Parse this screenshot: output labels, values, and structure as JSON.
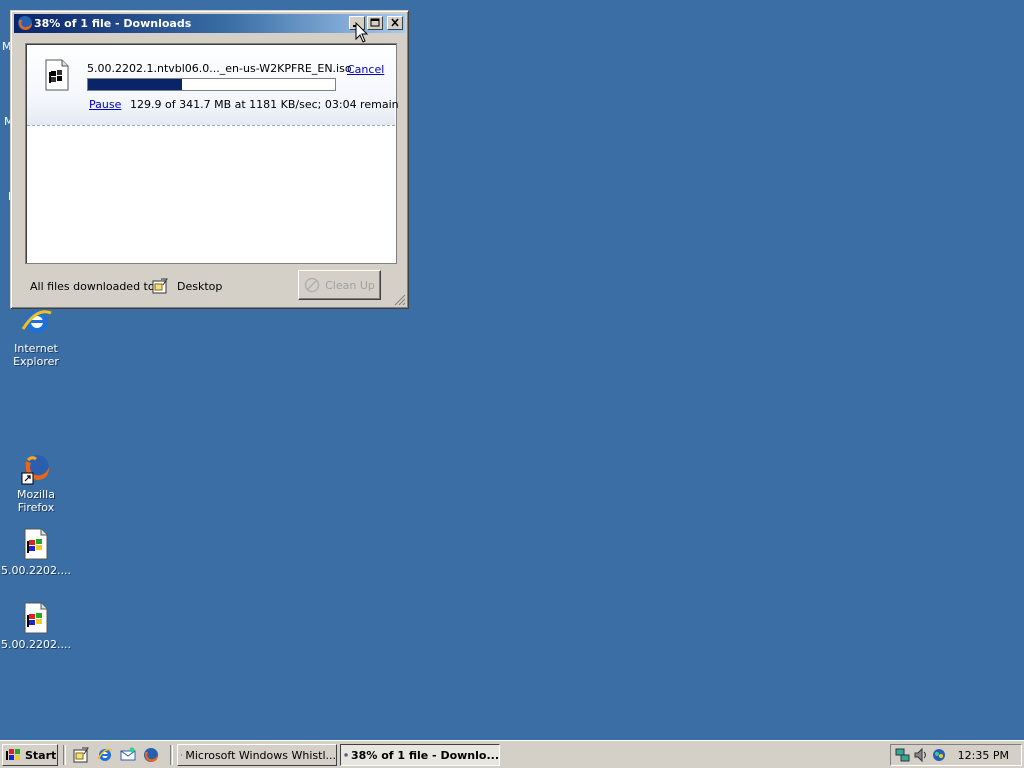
{
  "desktop": {
    "partial_labels": [
      "M",
      "M",
      "I"
    ],
    "icons": [
      {
        "label": "Internet Explorer",
        "icon": "internet-explorer-icon"
      },
      {
        "label": "Mozilla Firefox",
        "icon": "firefox-shortcut-icon"
      },
      {
        "label": "5.00.2202....",
        "icon": "iso-file-icon"
      },
      {
        "label": "5.00.2202....",
        "icon": "iso-file-icon"
      }
    ]
  },
  "window": {
    "title": "38% of 1 file - Downloads",
    "download": {
      "filename": "5.00.2202.1.ntvbl06.0..._en-us-W2KPFRE_EN.iso",
      "cancel_label": "Cancel",
      "pause_label": "Pause",
      "status": "129.9 of 341.7 MB at 1181 KB/sec; 03:04 remain",
      "progress_fraction": 0.38
    },
    "footer": {
      "label": "All files downloaded to:",
      "destination": "Desktop",
      "cleanup_label": "Clean Up"
    }
  },
  "taskbar": {
    "start_label": "Start",
    "quick_launch": [
      "show-desktop-icon",
      "internet-explorer-icon",
      "outlook-express-icon",
      "firefox-icon"
    ],
    "tasks": [
      {
        "label": "Microsoft Windows Whistl...",
        "active": false
      },
      {
        "label": "38% of 1 file - Downlo...",
        "active": true
      }
    ],
    "clock": "12:35 PM"
  },
  "colors": {
    "desktop": "#3a6ea5",
    "title_active": "#0a246a",
    "progress": "#0a246a",
    "link": "#0000cc"
  }
}
